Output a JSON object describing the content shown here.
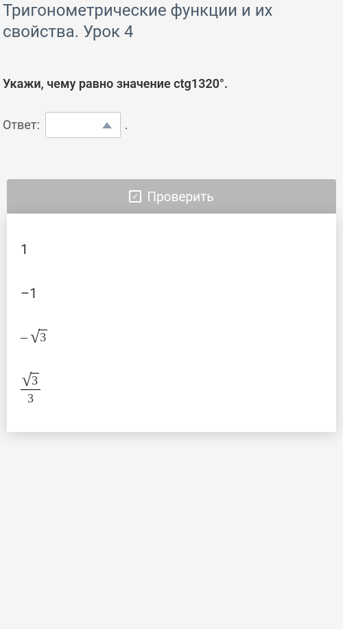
{
  "page_title": "Тригонометрические функции и их свойства. Урок 4",
  "question": "Укажи, чему равно значение ctg1320°.",
  "answer_label": "Ответ:",
  "answer_period": ".",
  "check_button_label": "Проверить",
  "options": [
    {
      "type": "plain",
      "value": "1"
    },
    {
      "type": "plain",
      "value": "–1"
    },
    {
      "type": "neg_sqrt",
      "arg": "3"
    },
    {
      "type": "frac_sqrt",
      "num_arg": "3",
      "den": "3"
    }
  ]
}
